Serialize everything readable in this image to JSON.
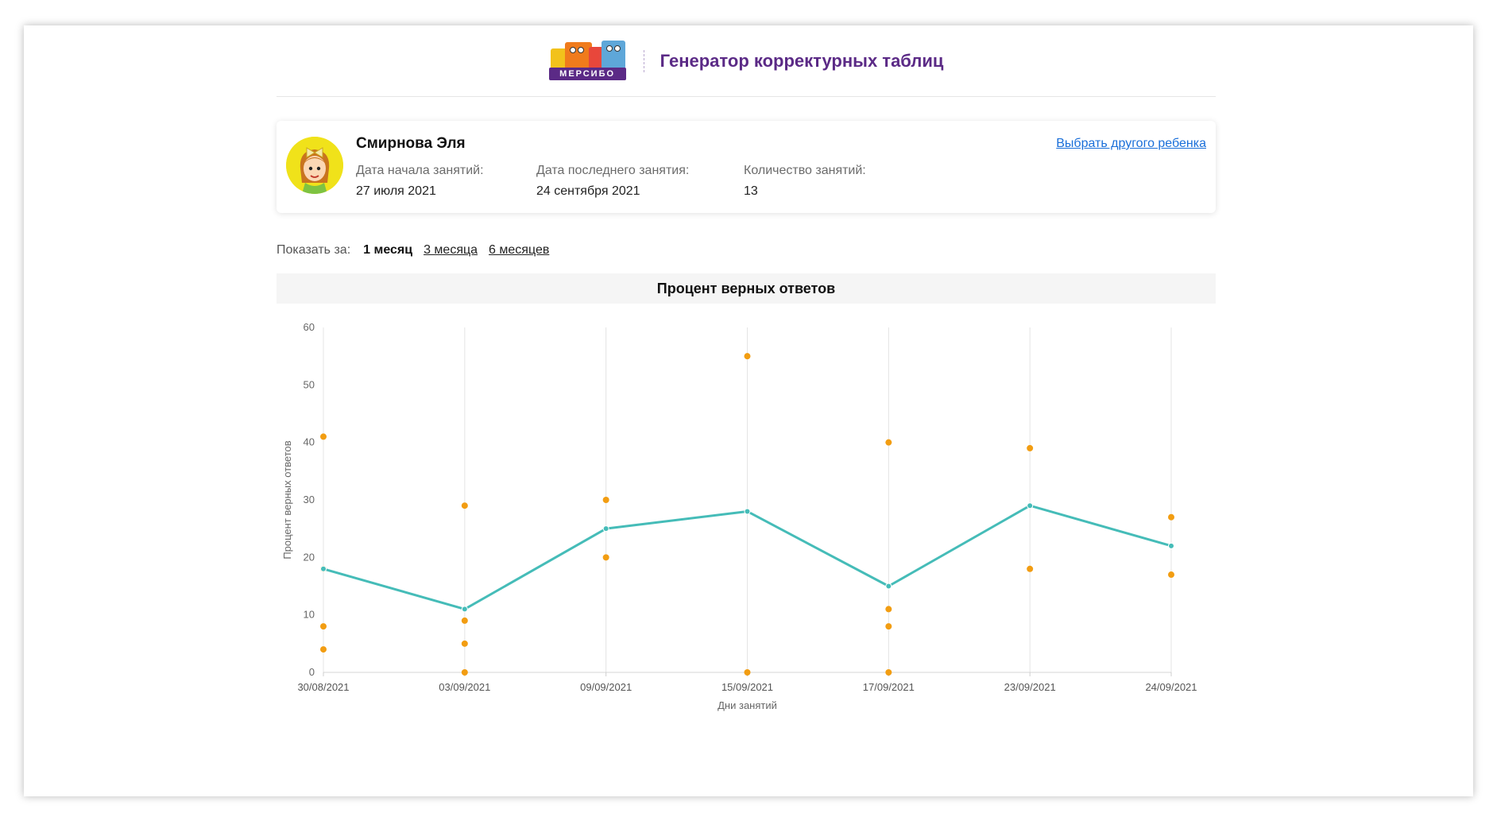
{
  "header": {
    "logo_text": "МЕРСИБО",
    "app_title": "Генератор корректурных таблиц"
  },
  "child": {
    "name": "Смирнова Эля",
    "start_label": "Дата начала занятий:",
    "start_value": "27 июля 2021",
    "last_label": "Дата последнего занятия:",
    "last_value": "24 сентября 2021",
    "count_label": "Количество занятий:",
    "count_value": "13",
    "change_link": "Выбрать другого ребенка"
  },
  "period": {
    "label": "Показать за:",
    "active": "1 месяц",
    "options": [
      "3 месяца",
      "6 месяцев"
    ]
  },
  "colors": {
    "brand": "#5b2a86",
    "link": "#1a6fd9",
    "line": "#45bcb8",
    "dots": "#f29d12"
  },
  "chart_data": {
    "type": "line",
    "title": "Процент верных ответов",
    "xlabel": "Дни занятий",
    "ylabel": "Процент верных ответов",
    "ylim": [
      0,
      60
    ],
    "yticks": [
      0,
      10,
      20,
      30,
      40,
      50,
      60
    ],
    "grid": "vertical",
    "categories": [
      "30/08/2021",
      "03/09/2021",
      "09/09/2021",
      "15/09/2021",
      "17/09/2021",
      "23/09/2021",
      "24/09/2021"
    ],
    "series": [
      {
        "kind": "line",
        "values": [
          18,
          11,
          25,
          28,
          15,
          29,
          22
        ]
      },
      {
        "kind": "scatter",
        "points": [
          [
            0,
            41
          ],
          [
            0,
            18
          ],
          [
            0,
            8
          ],
          [
            0,
            4
          ],
          [
            1,
            29
          ],
          [
            1,
            9
          ],
          [
            1,
            5
          ],
          [
            1,
            0
          ],
          [
            2,
            30
          ],
          [
            2,
            20
          ],
          [
            3,
            55
          ],
          [
            3,
            0
          ],
          [
            4,
            40
          ],
          [
            4,
            11
          ],
          [
            4,
            8
          ],
          [
            4,
            0
          ],
          [
            5,
            39
          ],
          [
            5,
            18
          ],
          [
            6,
            27
          ],
          [
            6,
            17
          ]
        ]
      }
    ]
  }
}
